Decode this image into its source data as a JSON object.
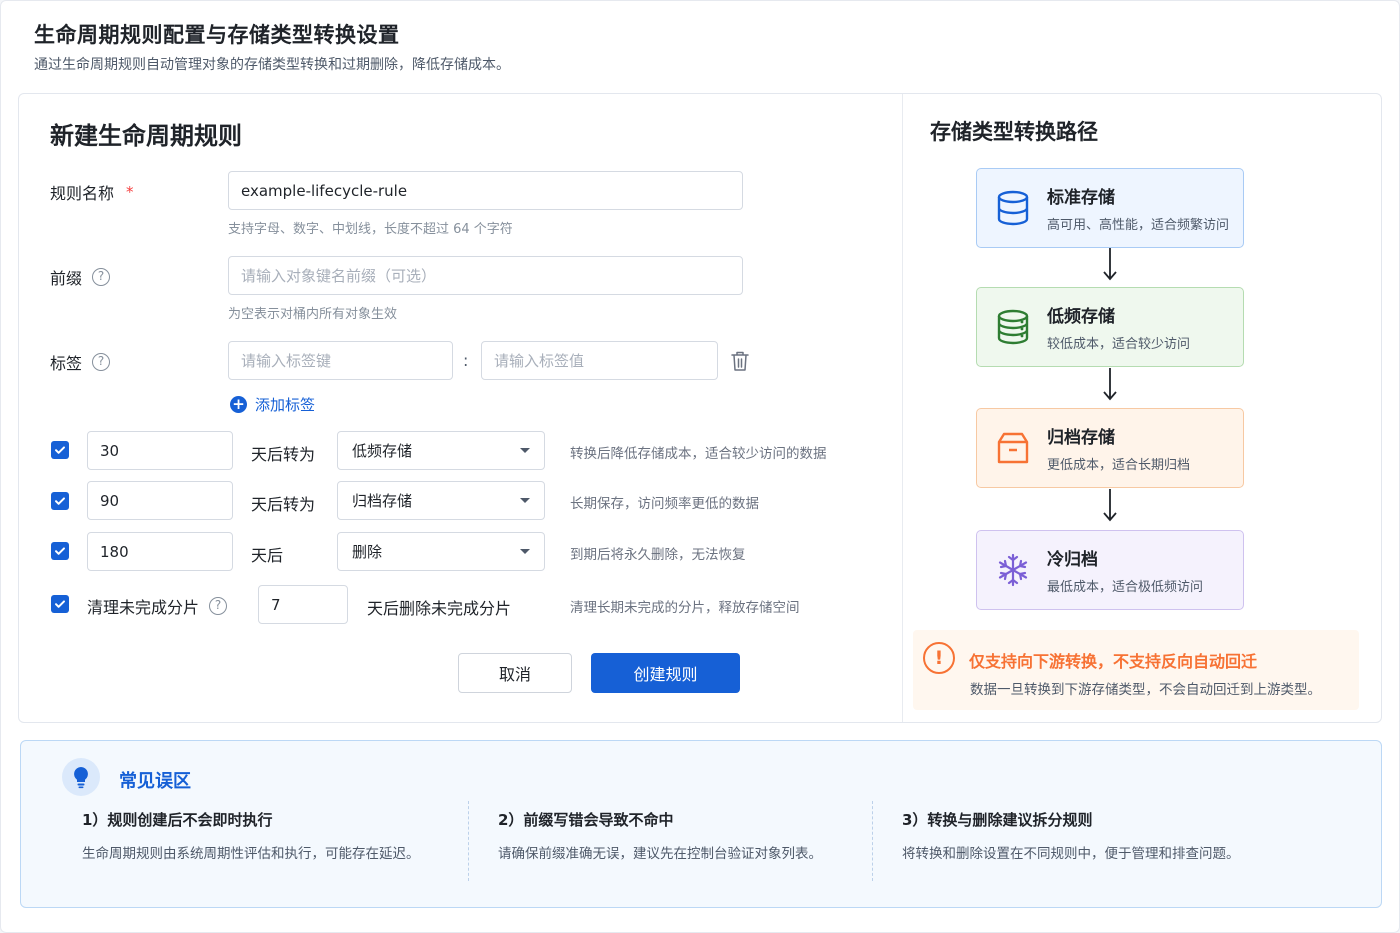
{
  "page": {
    "title": "生命周期规则配置与存储类型转换设置",
    "subtitle": "通过生命周期规则自动管理对象的存储类型转换和过期删除，降低存储成本。"
  },
  "form": {
    "title": "新建生命周期规则",
    "rule_name": {
      "label": "规则名称",
      "required_mark": "*",
      "value": "example-lifecycle-rule",
      "hint": "支持字母、数字、中划线，长度不超过 64 个字符"
    },
    "prefix": {
      "label": "前缀",
      "placeholder": "请输入对象键名前缀（可选）",
      "hint": "为空表示对桶内所有对象生效"
    },
    "tags": {
      "label": "标签",
      "key_placeholder": "请输入标签键",
      "colon": ":",
      "value_placeholder": "请输入标签值",
      "add_label": "添加标签"
    },
    "rules": [
      {
        "checked": true,
        "days": "30",
        "action": "天后转为",
        "target": "低频存储",
        "desc": "转换后降低存储成本，适合较少访问的数据"
      },
      {
        "checked": true,
        "days": "90",
        "action": "天后转为",
        "target": "归档存储",
        "desc": "长期保存，访问频率更低的数据"
      },
      {
        "checked": true,
        "days": "180",
        "action": "天后",
        "target": "删除",
        "desc": "到期后将永久删除，无法恢复"
      }
    ],
    "multipart": {
      "checked": true,
      "label": "清理未完成分片",
      "days": "7",
      "action": "天后删除未完成分片",
      "desc": "清理长期未完成的分片，释放存储空间"
    },
    "cancel_label": "取消",
    "create_label": "创建规则"
  },
  "path": {
    "title": "存储类型转换路径",
    "stages": [
      {
        "name": "标准存储",
        "sub": "高可用、高性能，适合频繁访问",
        "icon": "database-icon",
        "color": "#1660d6",
        "bg": "#eef5ff",
        "border": "#a9cbf5"
      },
      {
        "name": "低频存储",
        "sub": "较低成本，适合较少访问",
        "icon": "database-stack-icon",
        "color": "#2e7d32",
        "bg": "#eff8ee",
        "border": "#b5dcb1"
      },
      {
        "name": "归档存储",
        "sub": "更低成本，适合长期归档",
        "icon": "archive-box-icon",
        "color": "#f77234",
        "bg": "#fff4ea",
        "border": "#f7c9a3"
      },
      {
        "name": "冷归档",
        "sub": "最低成本，适合极低频访问",
        "icon": "snowflake-icon",
        "color": "#7b5fd6",
        "bg": "#f5f2fd",
        "border": "#cfc2ef"
      }
    ],
    "warning_title": "仅支持向下游转换，不支持反向自动回迁",
    "warning_text": "数据一旦转换到下游存储类型，不会自动回迁到上游类型。"
  },
  "tips": {
    "title": "常见误区",
    "items": [
      {
        "title": "1）规则创建后不会即时执行",
        "desc": "生命周期规则由系统周期性评估和执行，可能存在延迟。"
      },
      {
        "title": "2）前缀写错会导致不命中",
        "desc": "请确保前缀准确无误，建议先在控制台验证对象列表。"
      },
      {
        "title": "3）转换与删除建议拆分规则",
        "desc": "将转换和删除设置在不同规则中，便于管理和排查问题。"
      }
    ]
  }
}
